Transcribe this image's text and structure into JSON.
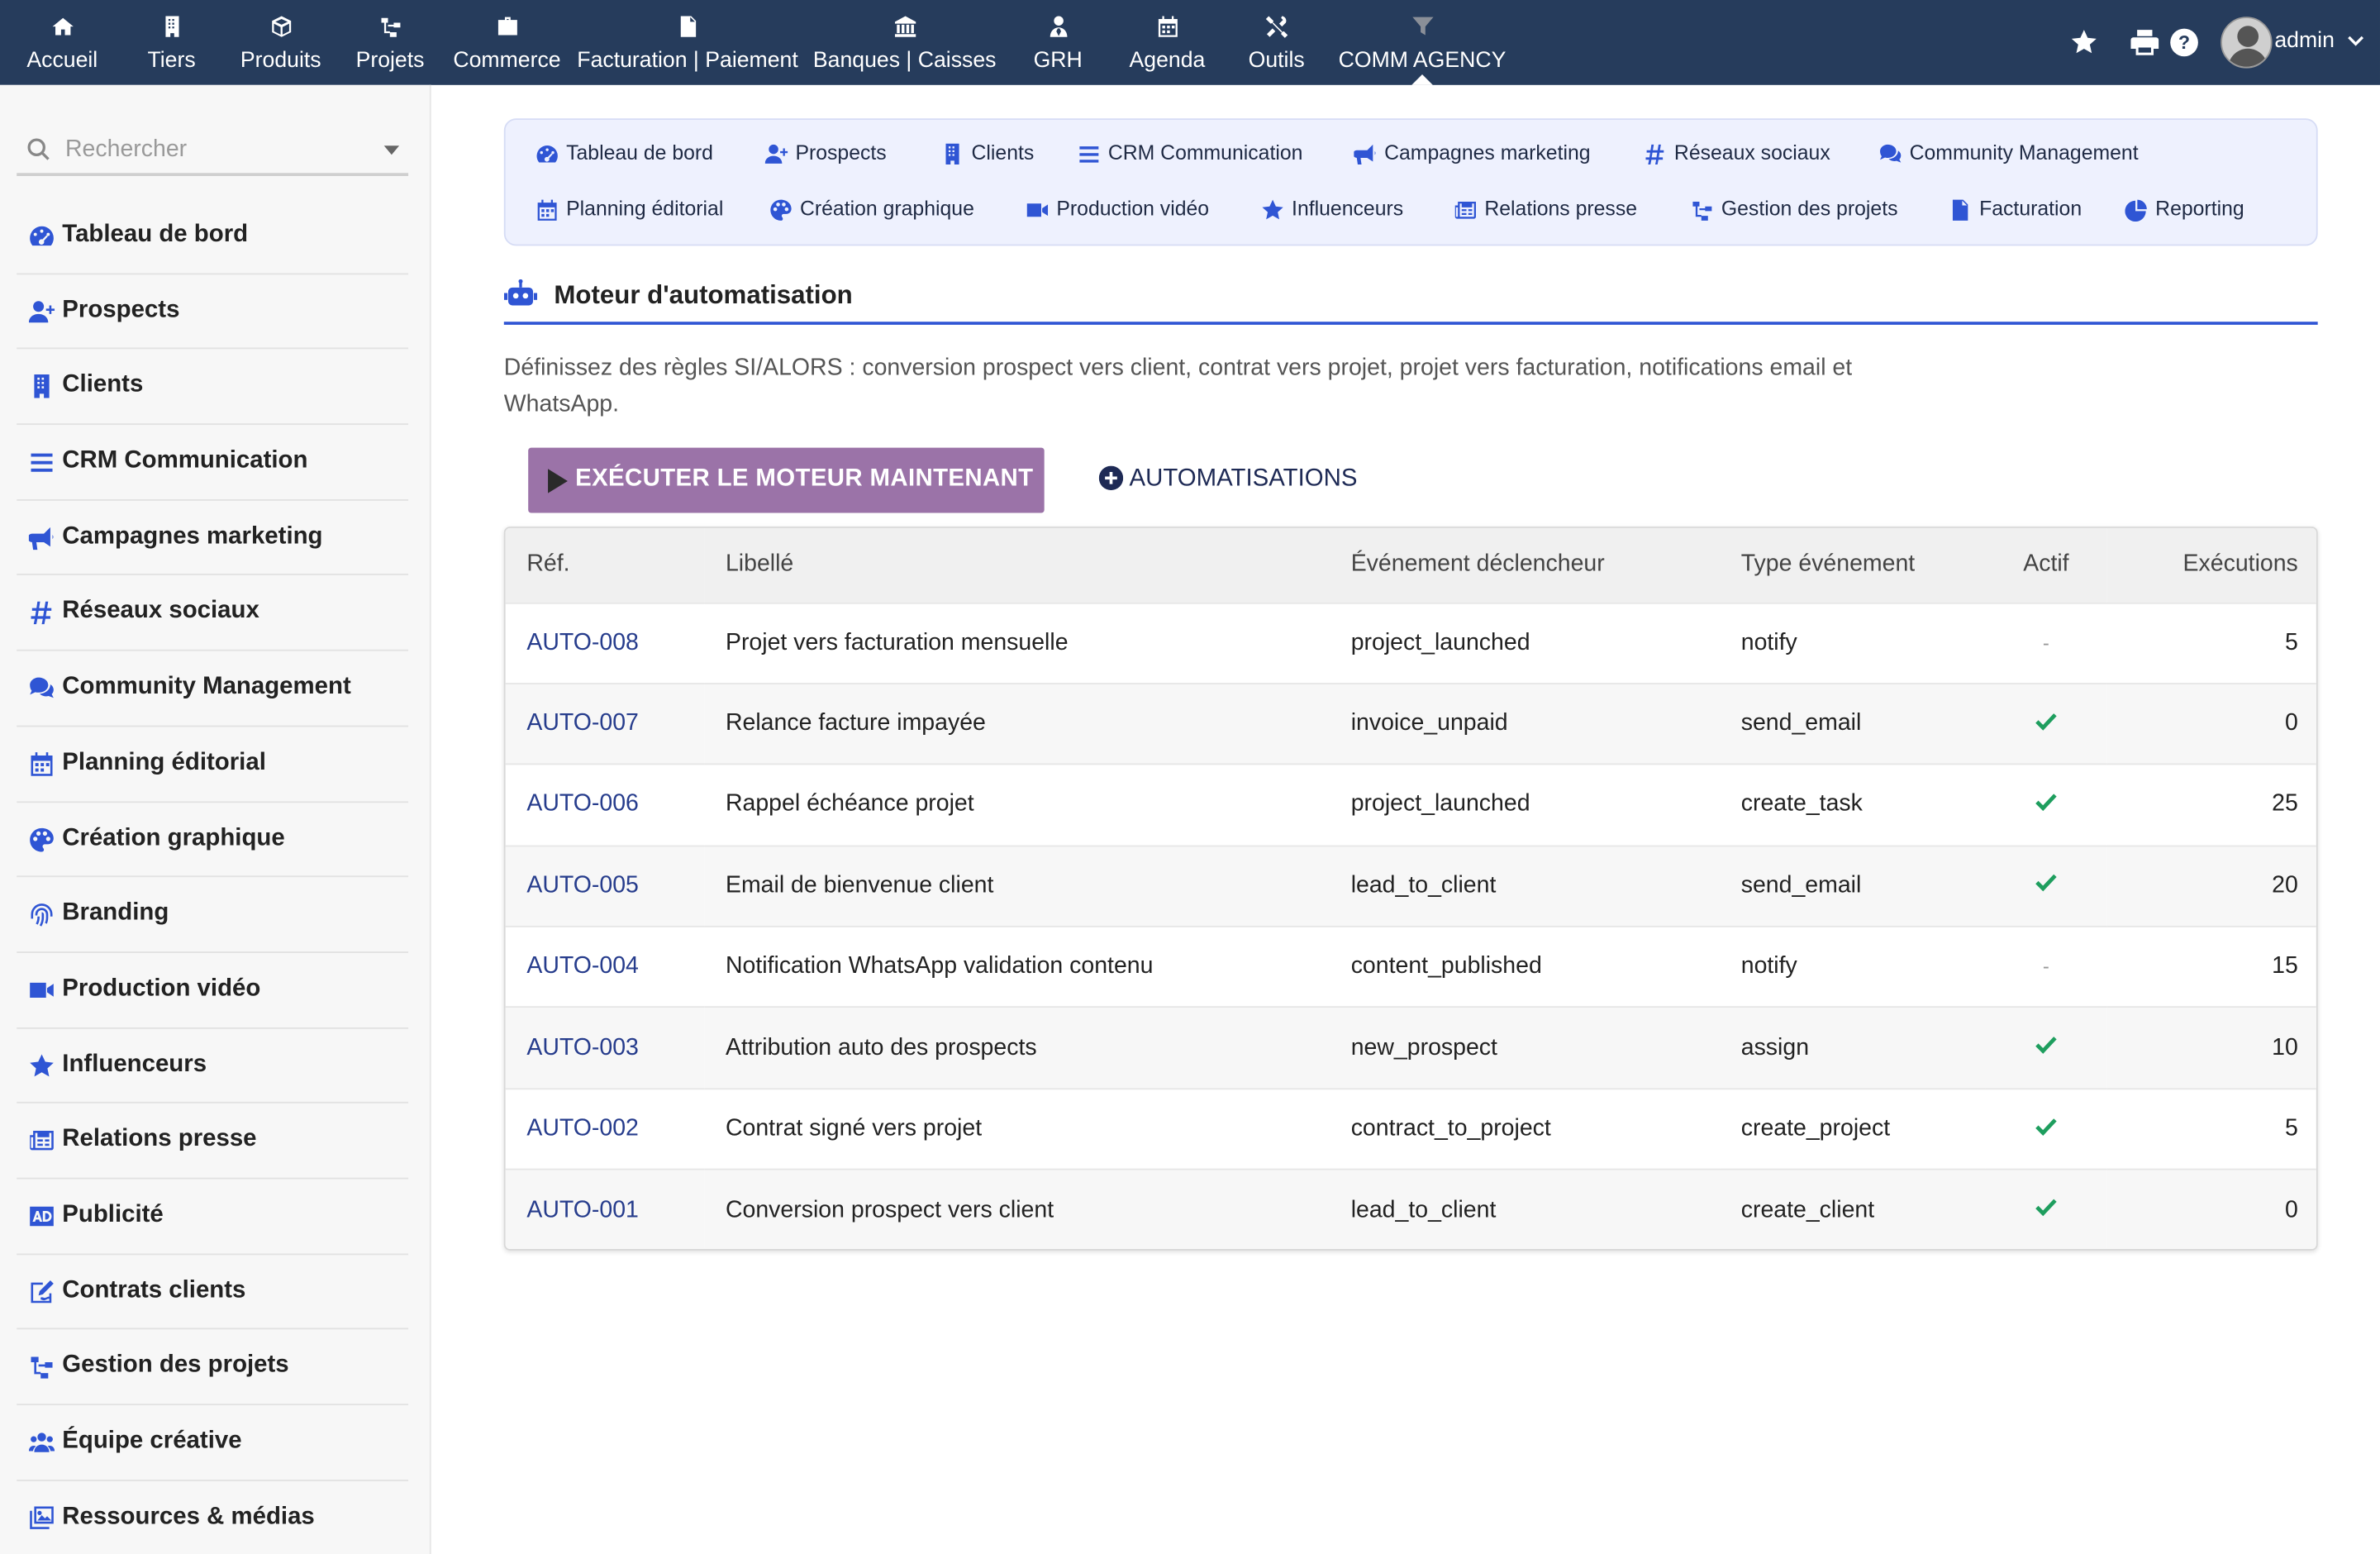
{
  "topbar": {
    "nav": [
      {
        "label": "Accueil",
        "icon": "home-icon"
      },
      {
        "label": "Tiers",
        "icon": "building-icon"
      },
      {
        "label": "Produits",
        "icon": "cube-icon"
      },
      {
        "label": "Projets",
        "icon": "sitemap-icon"
      },
      {
        "label": "Commerce",
        "icon": "briefcase-icon"
      },
      {
        "label": "Facturation | Paiement",
        "icon": "invoice-icon"
      },
      {
        "label": "Banques | Caisses",
        "icon": "bank-icon"
      },
      {
        "label": "GRH",
        "icon": "user-tie-icon"
      },
      {
        "label": "Agenda",
        "icon": "calendar-icon"
      },
      {
        "label": "Outils",
        "icon": "tools-icon"
      },
      {
        "label": "COMM AGENCY",
        "icon": "funnel-icon",
        "active": true
      }
    ],
    "user": "admin"
  },
  "sidebar": {
    "search_placeholder": "Rechercher",
    "items": [
      {
        "label": "Tableau de bord",
        "icon": "dashboard-icon"
      },
      {
        "label": "Prospects",
        "icon": "user-plus-icon"
      },
      {
        "label": "Clients",
        "icon": "building-icon"
      },
      {
        "label": "CRM Communication",
        "icon": "bars-icon"
      },
      {
        "label": "Campagnes marketing",
        "icon": "bullhorn-icon"
      },
      {
        "label": "Réseaux sociaux",
        "icon": "hashtag-icon"
      },
      {
        "label": "Community Management",
        "icon": "comments-icon"
      },
      {
        "label": "Planning éditorial",
        "icon": "calendar-icon"
      },
      {
        "label": "Création graphique",
        "icon": "palette-icon"
      },
      {
        "label": "Branding",
        "icon": "fingerprint-icon"
      },
      {
        "label": "Production vidéo",
        "icon": "video-icon"
      },
      {
        "label": "Influenceurs",
        "icon": "star-icon"
      },
      {
        "label": "Relations presse",
        "icon": "newspaper-icon"
      },
      {
        "label": "Publicité",
        "icon": "ad-icon"
      },
      {
        "label": "Contrats clients",
        "icon": "signature-icon"
      },
      {
        "label": "Gestion des projets",
        "icon": "sitemap-icon"
      },
      {
        "label": "Équipe créative",
        "icon": "users-icon"
      },
      {
        "label": "Ressources & médias",
        "icon": "images-icon"
      }
    ]
  },
  "module_nav": {
    "row1": [
      {
        "label": "Tableau de bord",
        "icon": "dashboard-icon"
      },
      {
        "label": "Prospects",
        "icon": "user-plus-icon"
      },
      {
        "label": "Clients",
        "icon": "building-icon"
      },
      {
        "label": "CRM Communication",
        "icon": "bars-icon"
      },
      {
        "label": "Campagnes marketing",
        "icon": "bullhorn-icon"
      },
      {
        "label": "Réseaux sociaux",
        "icon": "hashtag-icon"
      },
      {
        "label": "Community Management",
        "icon": "comments-icon"
      }
    ],
    "row2": [
      {
        "label": "Planning éditorial",
        "icon": "calendar-icon"
      },
      {
        "label": "Création graphique",
        "icon": "palette-icon"
      },
      {
        "label": "Production vidéo",
        "icon": "video-icon"
      },
      {
        "label": "Influenceurs",
        "icon": "star-icon"
      },
      {
        "label": "Relations presse",
        "icon": "newspaper-icon"
      },
      {
        "label": "Gestion des projets",
        "icon": "sitemap-icon"
      },
      {
        "label": "Facturation",
        "icon": "invoice-icon"
      },
      {
        "label": "Reporting",
        "icon": "chart-pie-icon"
      }
    ]
  },
  "section": {
    "title": "Moteur d'automatisation",
    "description": "Définissez des règles SI/ALORS : conversion prospect vers client, contrat vers projet, projet vers facturation, notifications email et WhatsApp.",
    "run_button": "EXÉCUTER LE MOTEUR MAINTENANT",
    "automations_link": "AUTOMATISATIONS"
  },
  "table": {
    "headers": {
      "ref": "Réf.",
      "label": "Libellé",
      "trigger": "Événement déclencheur",
      "type": "Type événement",
      "active": "Actif",
      "runs": "Exécutions"
    },
    "rows": [
      {
        "ref": "AUTO-008",
        "label": "Projet vers facturation mensuelle",
        "trigger": "project_launched",
        "type": "notify",
        "active": false,
        "runs": "5"
      },
      {
        "ref": "AUTO-007",
        "label": "Relance facture impayée",
        "trigger": "invoice_unpaid",
        "type": "send_email",
        "active": true,
        "runs": "0"
      },
      {
        "ref": "AUTO-006",
        "label": "Rappel échéance projet",
        "trigger": "project_launched",
        "type": "create_task",
        "active": true,
        "runs": "25"
      },
      {
        "ref": "AUTO-005",
        "label": "Email de bienvenue client",
        "trigger": "lead_to_client",
        "type": "send_email",
        "active": true,
        "runs": "20"
      },
      {
        "ref": "AUTO-004",
        "label": "Notification WhatsApp validation contenu",
        "trigger": "content_published",
        "type": "notify",
        "active": false,
        "runs": "15"
      },
      {
        "ref": "AUTO-003",
        "label": "Attribution auto des prospects",
        "trigger": "new_prospect",
        "type": "assign",
        "active": true,
        "runs": "10"
      },
      {
        "ref": "AUTO-002",
        "label": "Contrat signé vers projet",
        "trigger": "contract_to_project",
        "type": "create_project",
        "active": true,
        "runs": "5"
      },
      {
        "ref": "AUTO-001",
        "label": "Conversion prospect vers client",
        "trigger": "lead_to_client",
        "type": "create_client",
        "active": true,
        "runs": "0"
      }
    ],
    "inactive_mark": "-"
  },
  "colors": {
    "topbar": "#263c5c",
    "accent": "#2f55d4",
    "run_button": "#9b73a8",
    "check": "#1e9e5e"
  }
}
